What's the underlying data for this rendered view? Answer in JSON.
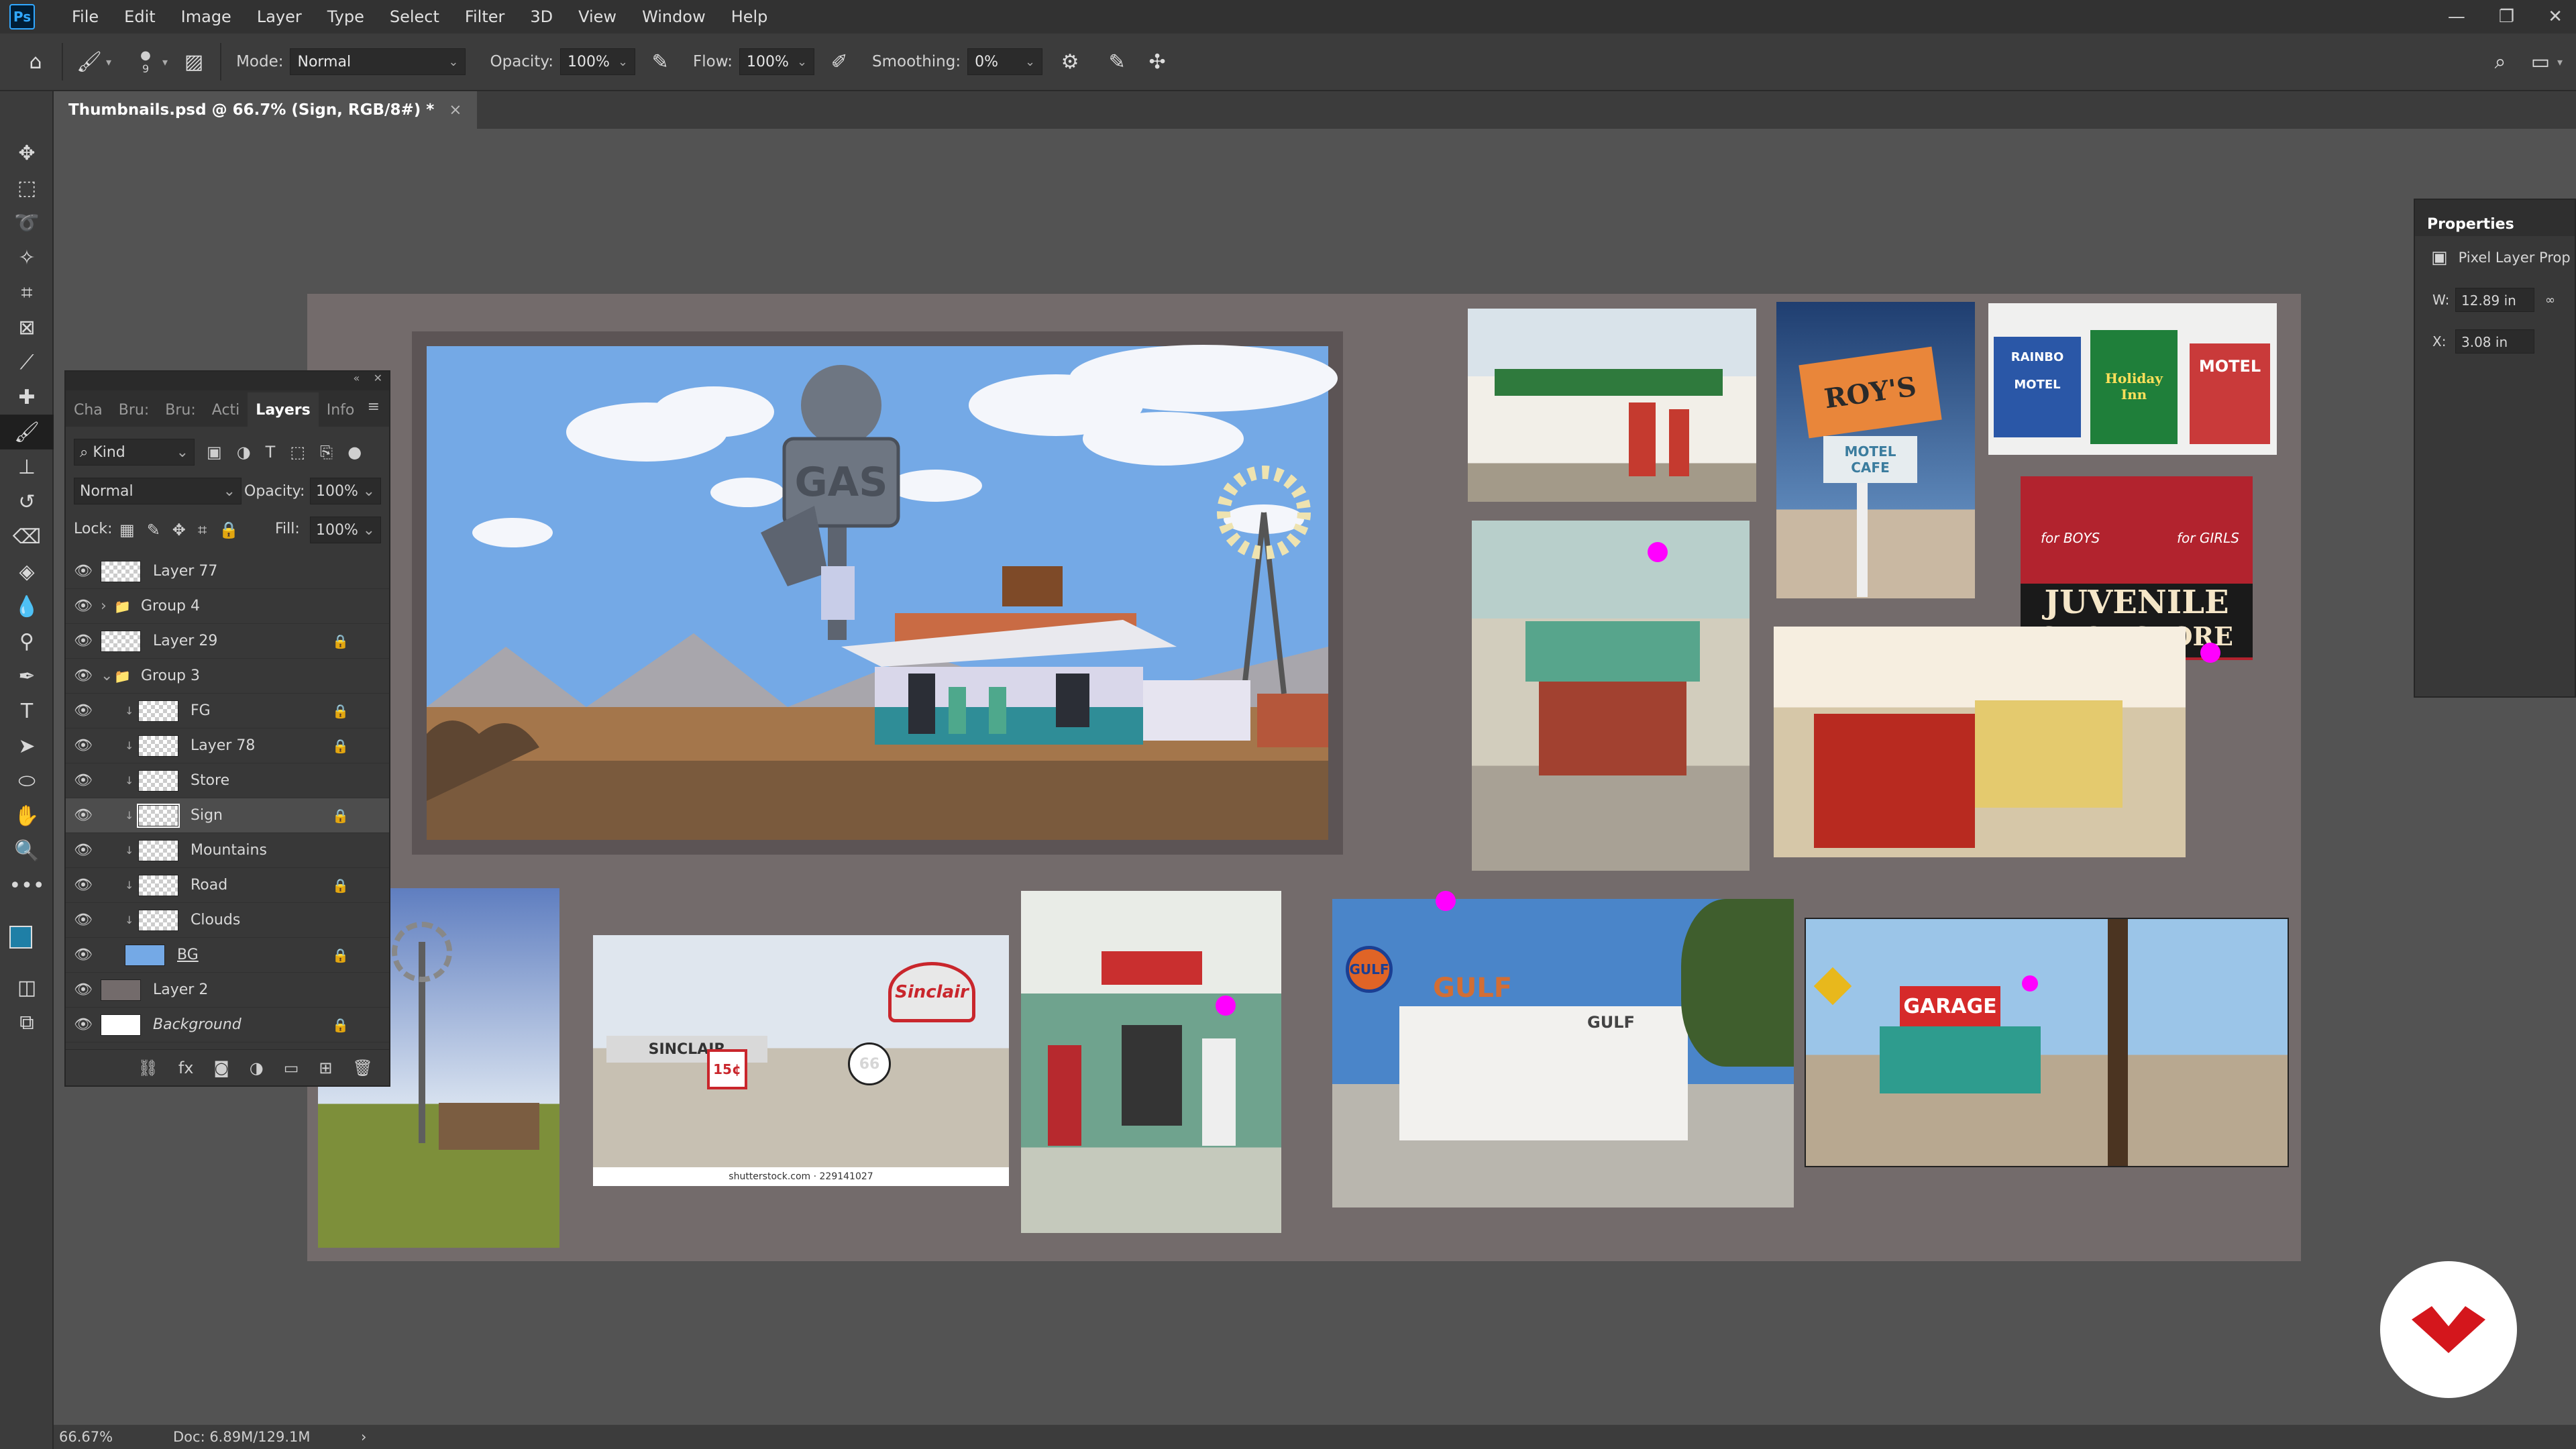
{
  "app": {
    "logo": "Ps"
  },
  "menu": [
    "File",
    "Edit",
    "Image",
    "Layer",
    "Type",
    "Select",
    "Filter",
    "3D",
    "View",
    "Window",
    "Help"
  ],
  "options": {
    "brush_size": "9",
    "mode_label": "Mode:",
    "mode_value": "Normal",
    "opacity_label": "Opacity:",
    "opacity_value": "100%",
    "flow_label": "Flow:",
    "flow_value": "100%",
    "smoothing_label": "Smoothing:",
    "smoothing_value": "0%"
  },
  "document": {
    "tab_title": "Thumbnails.psd @ 66.7% (Sign, RGB/8#) *",
    "close": "×"
  },
  "layers_panel": {
    "tabs": [
      "Cha",
      "Bru:",
      "Bru:",
      "Acti",
      "Layers",
      "Info"
    ],
    "active_tab": "Layers",
    "filter_label": "Kind",
    "blend_mode": "Normal",
    "opacity_label": "Opacity:",
    "opacity_value": "100%",
    "lock_label": "Lock:",
    "fill_label": "Fill:",
    "fill_value": "100%",
    "rows": [
      {
        "name": "Layer 77",
        "indent": 0,
        "kind": "pixel",
        "locked": false,
        "selected": false
      },
      {
        "name": "Group 4",
        "indent": 0,
        "kind": "group",
        "locked": false,
        "selected": false
      },
      {
        "name": "Layer 29",
        "indent": 0,
        "kind": "pixel",
        "locked": true,
        "selected": false
      },
      {
        "name": "Group 3",
        "indent": 0,
        "kind": "group-open",
        "locked": false,
        "selected": false
      },
      {
        "name": "FG",
        "indent": 1,
        "kind": "clip",
        "locked": true,
        "selected": false
      },
      {
        "name": "Layer 78",
        "indent": 1,
        "kind": "clip",
        "locked": true,
        "selected": false
      },
      {
        "name": "Store",
        "indent": 1,
        "kind": "clip",
        "locked": false,
        "selected": false
      },
      {
        "name": "Sign",
        "indent": 1,
        "kind": "clip",
        "locked": true,
        "selected": true
      },
      {
        "name": "Mountains",
        "indent": 1,
        "kind": "clip",
        "locked": false,
        "selected": false
      },
      {
        "name": "Road",
        "indent": 1,
        "kind": "clip",
        "locked": true,
        "selected": false
      },
      {
        "name": "Clouds",
        "indent": 1,
        "kind": "clip",
        "locked": false,
        "selected": false
      },
      {
        "name": "BG",
        "indent": 1,
        "kind": "bg",
        "locked": true,
        "selected": false
      },
      {
        "name": "Layer 2",
        "indent": 0,
        "kind": "solid",
        "locked": false,
        "selected": false
      },
      {
        "name": "Background",
        "indent": 0,
        "kind": "white",
        "locked": true,
        "selected": false
      }
    ]
  },
  "properties": {
    "title": "Properties",
    "subtitle": "Pixel Layer Prop",
    "w_label": "W:",
    "w_value": "12.89 in",
    "x_label": "X:",
    "x_value": "3.08 in"
  },
  "status": {
    "zoom": "66.67%",
    "doc": "Doc: 6.89M/129.1M",
    "arrow": "›"
  },
  "reference_signs": {
    "gas": "GAS",
    "roys": "ROY'S",
    "roys_sub": "MOTEL CAFE",
    "rainbo": "RAINBO",
    "motel": "MOTEL",
    "holiday": "Holiday Inn",
    "motel2": "MOTEL",
    "juvenile1": "JUVENILE",
    "juvenile2": "SHOE STORE",
    "forboys": "for BOYS",
    "forgirls": "for GIRLS",
    "sinclair": "Sinclair",
    "sinclair2": "SINCLAIR",
    "route66": "66",
    "price": "15¢",
    "shutterstock": "shutterstock.com · 229141027",
    "gulf": "GULF",
    "gulf2": "GULF",
    "gulf3": "GULF",
    "garage": "GARAGE"
  },
  "colors": {
    "accent": "#31a8ff",
    "canvas": "#736b6b",
    "workspace": "#535353",
    "marker": "#ff00ff"
  }
}
